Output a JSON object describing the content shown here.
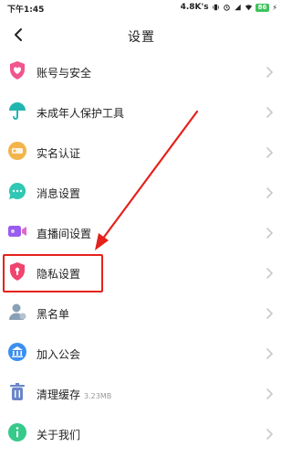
{
  "status_bar": {
    "time": "下午1:45",
    "network_speed": "4.8K's",
    "battery": "86"
  },
  "header": {
    "title": "设置"
  },
  "items": [
    {
      "id": "account",
      "label": "账号与安全",
      "icon": "shield-heart-icon",
      "color": "#f0558f"
    },
    {
      "id": "minor",
      "label": "未成年人保护工具",
      "icon": "umbrella-icon",
      "color": "#22b5b0"
    },
    {
      "id": "realname",
      "label": "实名认证",
      "icon": "id-badge-icon",
      "color": "#f3b44a"
    },
    {
      "id": "message",
      "label": "消息设置",
      "icon": "chat-bubble-icon",
      "color": "#2fc8b4"
    },
    {
      "id": "live",
      "label": "直播间设置",
      "icon": "video-camera-icon",
      "color": "#9a5cf0"
    },
    {
      "id": "privacy",
      "label": "隐私设置",
      "icon": "privacy-shield-icon",
      "color": "#f0456f"
    },
    {
      "id": "blacklist",
      "label": "黑名单",
      "icon": "user-block-icon",
      "color": "#8aa0b6"
    },
    {
      "id": "guild",
      "label": "加入公会",
      "icon": "bank-icon",
      "color": "#3b8ff2"
    },
    {
      "id": "cache",
      "label": "清理缓存",
      "sub": "3.23MB",
      "icon": "trash-icon",
      "color": "#6b86c9"
    },
    {
      "id": "about",
      "label": "关于我们",
      "icon": "info-icon",
      "color": "#36c98a"
    }
  ],
  "annotation": {
    "highlight_color": "#e5211b",
    "highlighted_item": "隐私设置"
  }
}
